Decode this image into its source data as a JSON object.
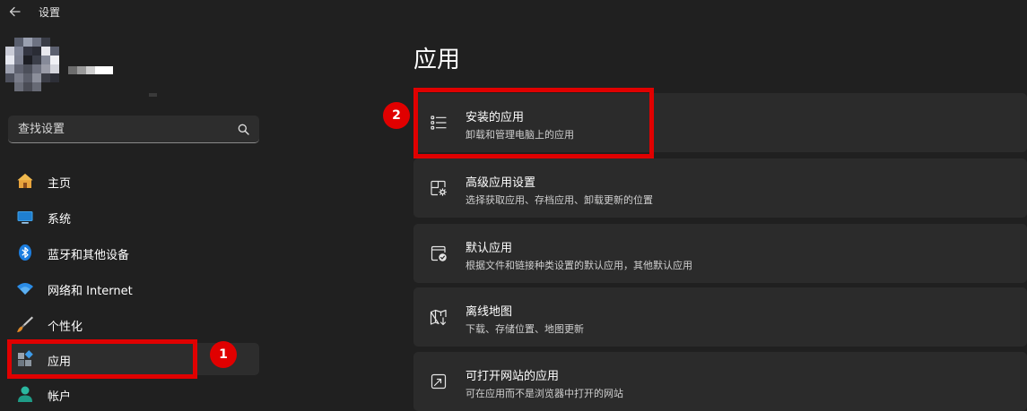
{
  "window": {
    "title": "设置"
  },
  "search": {
    "placeholder": "查找设置",
    "value": ""
  },
  "sidebar": {
    "items": [
      {
        "label": "主页",
        "icon": "home-icon"
      },
      {
        "label": "系统",
        "icon": "system-icon"
      },
      {
        "label": "蓝牙和其他设备",
        "icon": "bluetooth-icon"
      },
      {
        "label": "网络和 Internet",
        "icon": "wifi-icon"
      },
      {
        "label": "个性化",
        "icon": "brush-icon"
      },
      {
        "label": "应用",
        "icon": "apps-icon",
        "selected": true
      },
      {
        "label": "帐户",
        "icon": "account-icon"
      }
    ]
  },
  "main": {
    "title": "应用",
    "cards": [
      {
        "title": "安装的应用",
        "subtitle": "卸载和管理电脑上的应用",
        "icon": "list-icon"
      },
      {
        "title": "高级应用设置",
        "subtitle": "选择获取应用、存档应用、卸载更新的位置",
        "icon": "app-settings-icon"
      },
      {
        "title": "默认应用",
        "subtitle": "根据文件和链接种类设置的默认应用，其他默认应用",
        "icon": "default-apps-icon"
      },
      {
        "title": "离线地图",
        "subtitle": "下载、存储位置、地图更新",
        "icon": "map-icon"
      },
      {
        "title": "可打开网站的应用",
        "subtitle": "可在应用而不是浏览器中打开的网站",
        "icon": "open-website-icon"
      }
    ]
  },
  "annotations": {
    "badge1": "1",
    "badge2": "2",
    "color": "#e00000"
  },
  "colors": {
    "background": "#202020",
    "card": "#2b2b2b",
    "selected": "#2d2d2d",
    "accent": "#0078d4"
  }
}
